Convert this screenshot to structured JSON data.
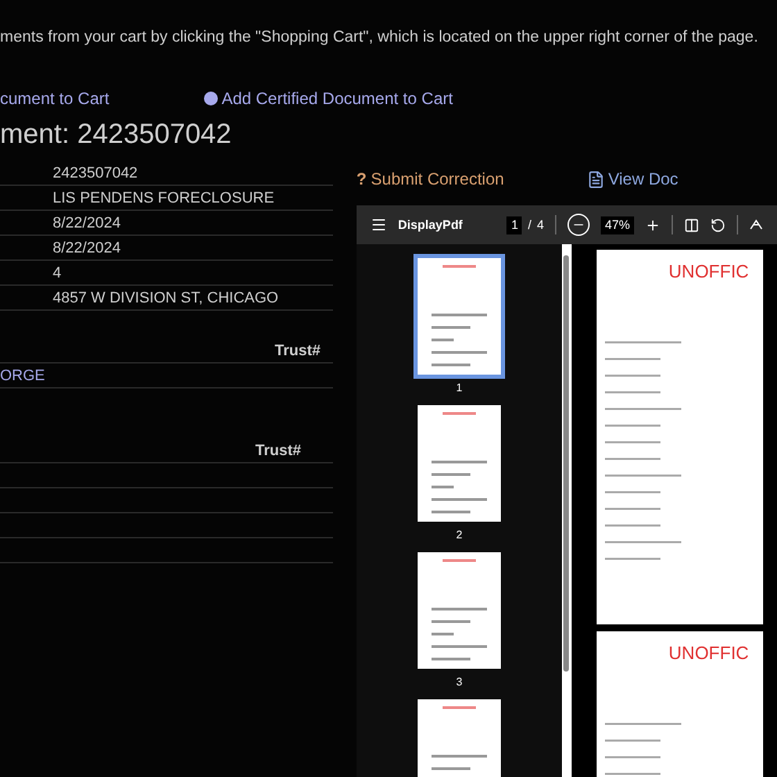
{
  "notice": "ments from your cart by clicking the \"Shopping Cart\", which is located on the upper right corner of the page.",
  "cart_links": [
    {
      "label": "cument to Cart",
      "icon": false
    },
    {
      "label": "Add Certified Document to Cart",
      "icon": true
    }
  ],
  "heading": "ment: 2423507042",
  "details": [
    "2423507042",
    "LIS PENDENS FORECLOSURE",
    "8/22/2024",
    "8/22/2024",
    "4",
    "4857 W DIVISION ST, CHICAGO"
  ],
  "grantors": {
    "column_header": "Trust#",
    "rows": [
      "ORGE"
    ]
  },
  "grantees": {
    "column_header": "Trust#"
  },
  "submit_correction": {
    "icon": "?",
    "label": "Submit Correction"
  },
  "view_document": "View Doc",
  "pdf_viewer": {
    "title": "DisplayPdf",
    "page": "1",
    "separator": "/",
    "page_count": "4",
    "zoom": "47%",
    "thumbnails": [
      {
        "label": "1",
        "selected": true
      },
      {
        "label": "2",
        "selected": false
      },
      {
        "label": "3",
        "selected": false
      },
      {
        "selected": false
      }
    ],
    "pages": [
      {
        "heading": "UNOFFIC"
      },
      {
        "heading": "UNOFFIC"
      }
    ]
  }
}
